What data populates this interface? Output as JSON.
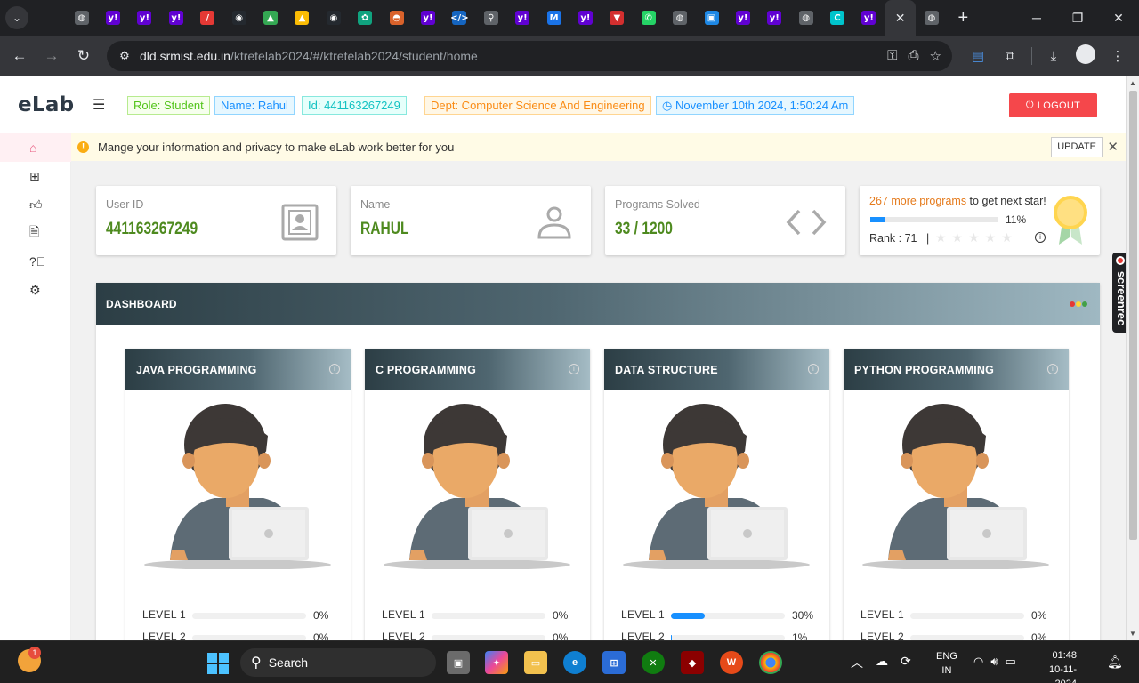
{
  "browser": {
    "url_host": "dld.srmist.edu.in",
    "url_path": "/ktretelab2024/#/ktretelab2024/student/home",
    "tabs": [
      {
        "icon": "globe-icon",
        "color": "#5f6368"
      },
      {
        "icon": "yahoo-icon",
        "color": "#6001d2"
      },
      {
        "icon": "yahoo-icon",
        "color": "#6001d2"
      },
      {
        "icon": "yahoo-icon",
        "color": "#6001d2"
      },
      {
        "icon": "slash-icon",
        "color": "#e53935"
      },
      {
        "icon": "github-icon",
        "color": "#24292f"
      },
      {
        "icon": "drive-icon",
        "color": "#34a853"
      },
      {
        "icon": "drive-icon",
        "color": "#fbbc04"
      },
      {
        "icon": "github-icon",
        "color": "#24292f"
      },
      {
        "icon": "openai-icon",
        "color": "#10a37f"
      },
      {
        "icon": "hat-icon",
        "color": "#d9622b"
      },
      {
        "icon": "yahoo-icon",
        "color": "#6001d2"
      },
      {
        "icon": "code-icon",
        "color": "#1565c0"
      },
      {
        "icon": "search-icon",
        "color": "#5f6368"
      },
      {
        "icon": "yahoo-icon",
        "color": "#6001d2"
      },
      {
        "icon": "mdn-icon",
        "color": "#1a73e8"
      },
      {
        "icon": "yahoo-icon",
        "color": "#6001d2"
      },
      {
        "icon": "vercel-icon",
        "color": "#d32f2f"
      },
      {
        "icon": "whatsapp-icon",
        "color": "#25d366"
      },
      {
        "icon": "globe-icon",
        "color": "#5f6368"
      },
      {
        "icon": "photo-icon",
        "color": "#1e88e5"
      },
      {
        "icon": "yahoo-icon",
        "color": "#6001d2"
      },
      {
        "icon": "yahoo-icon",
        "color": "#6001d2"
      },
      {
        "icon": "globe-icon",
        "color": "#5f6368"
      },
      {
        "icon": "canva-icon",
        "color": "#00c4cc"
      },
      {
        "icon": "yahoo-icon",
        "color": "#6001d2"
      }
    ]
  },
  "header": {
    "logo": "eLab",
    "role": "Role: Student",
    "name": "Name: Rahul",
    "id": "Id: 441163267249",
    "dept": "Dept: Computer Science And Engineering",
    "datetime": "November 10th 2024, 1:50:24 Am",
    "logout": "LOGOUT"
  },
  "notice": {
    "text": "Mange your information and privacy to make eLab work better for you",
    "button": "UPDATE"
  },
  "stats": {
    "user_id_label": "User ID",
    "user_id": "441163267249",
    "name_label": "Name",
    "name": "RAHUL",
    "programs_label": "Programs Solved",
    "programs": "33 / 1200",
    "more_count": "267 more programs",
    "more_rest": " to get next star!",
    "progress_pct": "11%",
    "progress_value": 0.11,
    "rank": "Rank : 71",
    "rank_sep": "|"
  },
  "dashboard": {
    "title": "DASHBOARD",
    "courses": [
      {
        "title": "JAVA PROGRAMMING",
        "levels": [
          {
            "label": "LEVEL 1",
            "pct": "0%",
            "value": 0
          },
          {
            "label": "LEVEL 2",
            "pct": "0%",
            "value": 0
          }
        ]
      },
      {
        "title": "C PROGRAMMING",
        "levels": [
          {
            "label": "LEVEL 1",
            "pct": "0%",
            "value": 0
          },
          {
            "label": "LEVEL 2",
            "pct": "0%",
            "value": 0
          }
        ]
      },
      {
        "title": "DATA STRUCTURE",
        "levels": [
          {
            "label": "LEVEL 1",
            "pct": "30%",
            "value": 0.3
          },
          {
            "label": "LEVEL 2",
            "pct": "1%",
            "value": 0.01
          }
        ]
      },
      {
        "title": "PYTHON PROGRAMMING",
        "levels": [
          {
            "label": "LEVEL 1",
            "pct": "0%",
            "value": 0
          },
          {
            "label": "LEVEL 2",
            "pct": "0%",
            "value": 0
          }
        ]
      }
    ]
  },
  "overlay": {
    "screenrec": "screenrec"
  },
  "taskbar": {
    "search": "Search",
    "notif_count": "1",
    "lang1": "ENG",
    "lang2": "IN",
    "time": "01:48",
    "date": "10-11-2024"
  }
}
